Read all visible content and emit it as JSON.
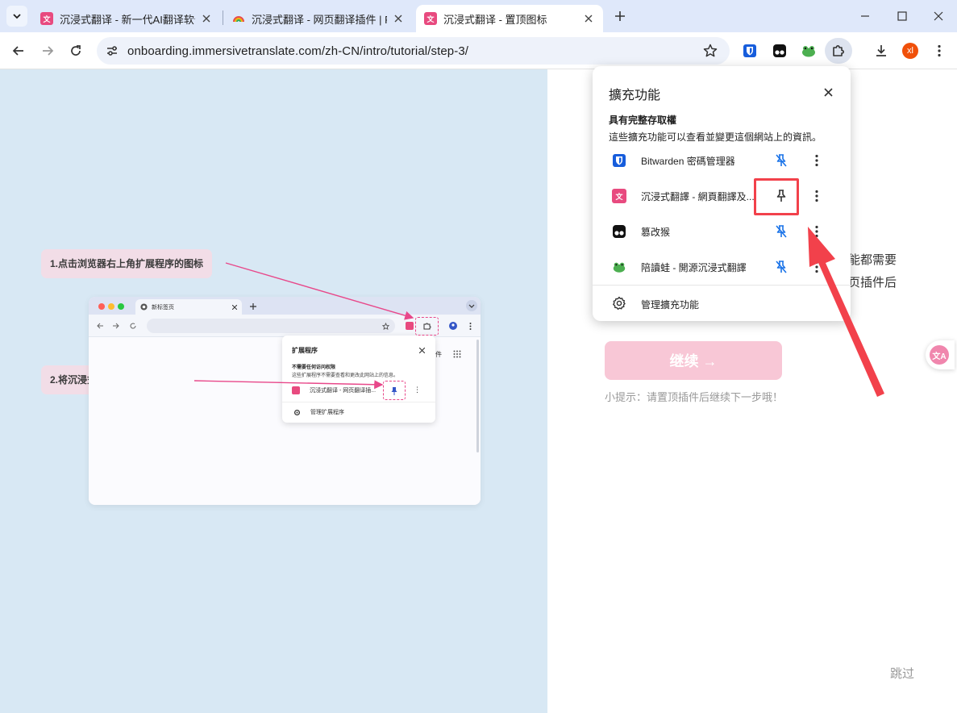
{
  "tabs": [
    {
      "title": "沉浸式翻译 - 新一代AI翻译软件"
    },
    {
      "title": "沉浸式翻译 - 网页翻译插件 | PDF"
    },
    {
      "title": "沉浸式翻译 - 置顶图标"
    }
  ],
  "new_tab_symbol": "+",
  "address_bar": {
    "url": "onboarding.immersivetranslate.com/zh-CN/intro/tutorial/step-3/"
  },
  "profile": {
    "initials": "xl"
  },
  "illustration": {
    "step1": "1.点击浏览器右上角扩展程序的图标",
    "step2": "2.将沉浸式翻译固定到工具栏",
    "mini_tab_title": "新标签页",
    "mini_menu_glyph": "⋮",
    "mini_partial_label": "件",
    "mini_popup": {
      "title": "扩展程序",
      "section": "不需要任何访问权限",
      "desc": "这些扩展程序不需要查看和更改此网站上的信息。",
      "item": "沉浸式翻译 - 网页翻译插...",
      "manage": "管理扩展程序"
    }
  },
  "page_right": {
    "partial_line1": "能都需要",
    "partial_line2": "页插件后",
    "continue_button": "继续 →",
    "hint": "小提示：请置顶插件后继续下一步哦！",
    "skip": "跳过",
    "float_glyph": "文A"
  },
  "extensions_popup": {
    "title": "擴充功能",
    "section_title": "具有完整存取權",
    "section_desc": "這些擴充功能可以查看並變更這個網站上的資訊。",
    "items": [
      {
        "name": "Bitwarden 密碼管理器",
        "pinned": false
      },
      {
        "name": "沉浸式翻譯 - 網頁翻譯及...",
        "pinned": true
      },
      {
        "name": "篡改猴",
        "pinned": false
      },
      {
        "name": "陪讀蛙 - 開源沉浸式翻譯",
        "pinned": false
      }
    ],
    "manage_label": "管理擴充功能"
  },
  "colors": {
    "brand_pink": "#e84a7f",
    "highlight_red": "#f2414b",
    "pin_blue": "#1a73e8"
  }
}
